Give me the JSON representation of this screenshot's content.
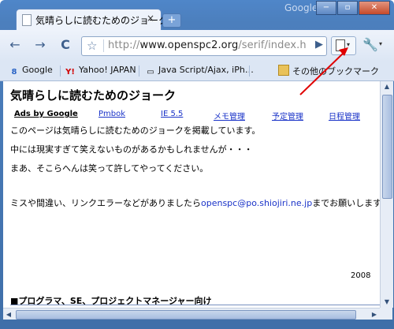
{
  "window": {
    "brand": "Google",
    "controls": {
      "minimize": "−",
      "restore": "▫",
      "close": "✕"
    }
  },
  "tab": {
    "title": "気晴らしに読むためのジョーク",
    "close": "×",
    "new_tab": "+"
  },
  "toolbar": {
    "back": "←",
    "forward": "→",
    "reload": "C",
    "star": "☆",
    "url_scheme": "http://",
    "url_host": "www.openspc2.org",
    "url_path": "/serif/index.h",
    "go": "▶",
    "page_menu_caret": "▾",
    "wrench_caret": "▾"
  },
  "bookmarks": {
    "items": [
      {
        "label": "Google",
        "icon": "8"
      },
      {
        "label": "Yahoo! JAPAN",
        "icon": "Y!"
      },
      {
        "label": "Java Script/Ajax, iPh…",
        "icon": "▭"
      }
    ],
    "other": "その他のブックマーク"
  },
  "page": {
    "heading": "気晴らしに読むためのジョーク",
    "ads_label": "Ads by Google",
    "nav_links": [
      "Pmbok",
      "IE 5.5",
      "メモ管理",
      "予定管理",
      "日程管理"
    ],
    "paragraphs": [
      "このページは気晴らしに読むためのジョークを掲載しています。",
      "中には現実すぎて笑えないものがあるかもしれませんが・・・",
      "まあ、そこらへんは笑って許してやってください。"
    ],
    "contact_prefix": "ミスや間違い、リンクエラーなどがありましたら",
    "contact_email": "openspc@po.shiojiri.ne.jp",
    "contact_suffix": "までお願いします",
    "year": "2008",
    "section_heading": "■プログラマ、SE、プロジェクトマネージャー向け"
  },
  "colors": {
    "frame": "#4c7fbd",
    "link": "#1a33c8",
    "annotation_arrow": "#e00000"
  }
}
